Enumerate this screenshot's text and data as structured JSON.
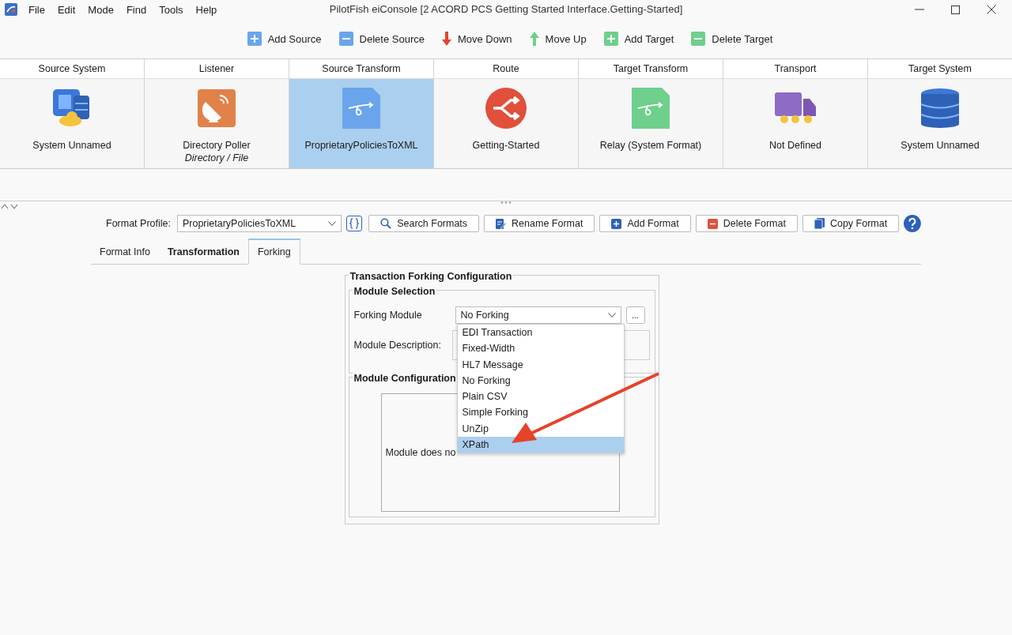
{
  "menu": [
    "File",
    "Edit",
    "Mode",
    "Find",
    "Tools",
    "Help"
  ],
  "window": {
    "title": "PilotFish eiConsole [2 ACORD PCS Getting Started Interface.Getting-Started]"
  },
  "toolbar": [
    {
      "label": "Add Source",
      "kind": "add-blue"
    },
    {
      "label": "Delete Source",
      "kind": "delete-blue"
    },
    {
      "label": "Move Down",
      "kind": "down"
    },
    {
      "label": "Move Up",
      "kind": "up"
    },
    {
      "label": "Add Target",
      "kind": "add-green"
    },
    {
      "label": "Delete Target",
      "kind": "delete-green"
    }
  ],
  "pipeline": [
    {
      "header": "Source System",
      "name": "System Unnamed",
      "kind": "system",
      "selected": false
    },
    {
      "header": "Listener",
      "name": "Directory Poller",
      "subtitle": "Directory / File",
      "kind": "listener",
      "selected": false
    },
    {
      "header": "Source Transform",
      "name": "ProprietaryPoliciesToXML",
      "kind": "transform-blue",
      "selected": true
    },
    {
      "header": "Route",
      "name": "Getting-Started",
      "kind": "route",
      "selected": false
    },
    {
      "header": "Target Transform",
      "name": "Relay (System Format)",
      "kind": "transform-green",
      "selected": false
    },
    {
      "header": "Transport",
      "name": "Not Defined",
      "kind": "transport",
      "selected": false
    },
    {
      "header": "Target System",
      "name": "System Unnamed",
      "kind": "database",
      "selected": false
    }
  ],
  "format_profile": {
    "label": "Format Profile:",
    "value": "ProprietaryPoliciesToXML"
  },
  "format_buttons": [
    {
      "label": "Search Formats",
      "kind": "search"
    },
    {
      "label": "Rename Format",
      "kind": "rename"
    },
    {
      "label": "Add Format",
      "kind": "add"
    },
    {
      "label": "Delete Format",
      "kind": "delete"
    },
    {
      "label": "Copy Format",
      "kind": "copy"
    }
  ],
  "tabs": [
    {
      "label": "Format Info",
      "selected": false,
      "bold": false
    },
    {
      "label": "Transformation",
      "selected": false,
      "bold": true
    },
    {
      "label": "Forking",
      "selected": true,
      "bold": false
    }
  ],
  "forking": {
    "title": "Transaction Forking Configuration",
    "selection_title": "Module Selection",
    "module_label": "Forking Module",
    "module_value": "No Forking",
    "browse_label": "...",
    "description_label": "Module Description:",
    "config_title": "Module Configuration",
    "config_text": "Module does no",
    "options": [
      {
        "label": "EDI Transaction",
        "selected": false
      },
      {
        "label": "Fixed-Width",
        "selected": false
      },
      {
        "label": "HL7 Message",
        "selected": false
      },
      {
        "label": "No Forking",
        "selected": false
      },
      {
        "label": "Plain CSV",
        "selected": false
      },
      {
        "label": "Simple Forking",
        "selected": false
      },
      {
        "label": "UnZip",
        "selected": false
      },
      {
        "label": "XPath",
        "selected": true
      }
    ]
  }
}
